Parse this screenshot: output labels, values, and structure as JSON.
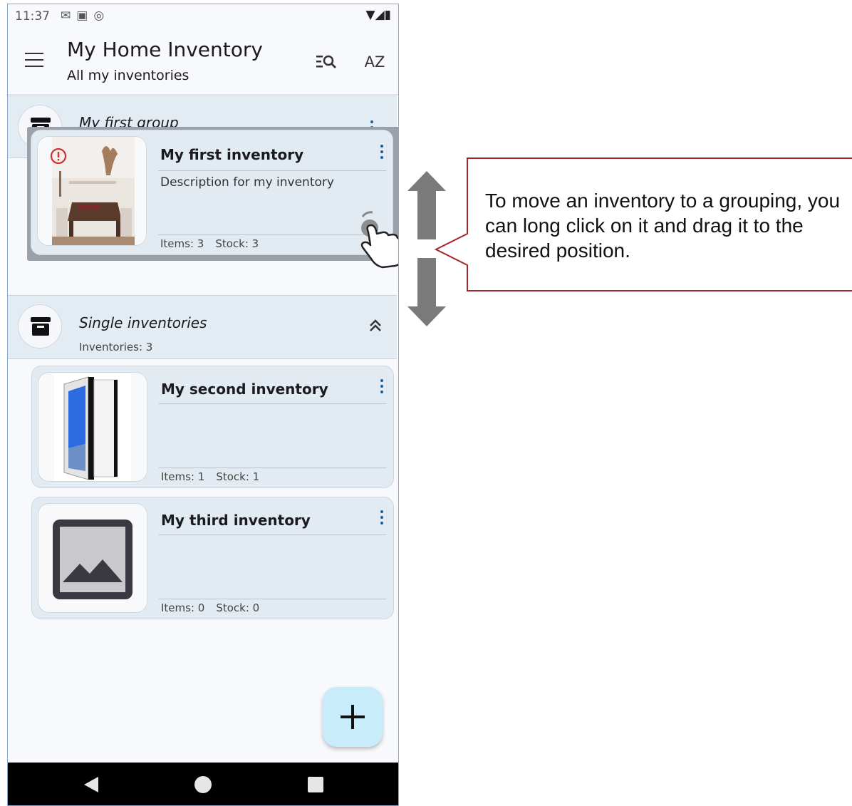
{
  "status_bar": {
    "time": "11:37",
    "left_icons": [
      "gmail-icon",
      "app-icon",
      "sync-icon"
    ],
    "right_icons": [
      "wifi-icon",
      "signal-icon",
      "battery-icon"
    ]
  },
  "app_bar": {
    "title": "My Home Inventory",
    "subtitle": "All my inventories",
    "sort_label": "AZ"
  },
  "groups": [
    {
      "name": "My first group"
    },
    {
      "name": "Single inventories",
      "count_label": "Inventories: 3"
    }
  ],
  "inventories": [
    {
      "name": "My first inventory",
      "description": "Description for my inventory",
      "items": "Items: 3",
      "stock": "Stock: 3",
      "image": "room-photo",
      "has_warning": true
    },
    {
      "name": "My second inventory",
      "description": "",
      "items": "Items: 1",
      "stock": "Stock: 1",
      "image": "pc-case-photo"
    },
    {
      "name": "My third inventory",
      "description": "",
      "items": "Items: 0",
      "stock": "Stock: 0",
      "image": "placeholder-image-icon"
    }
  ],
  "fab": {
    "icon": "plus-icon"
  },
  "nav": [
    "back-icon",
    "home-icon",
    "recents-icon"
  ],
  "annotation": {
    "text": "To move an inventory to a grouping, you can long click on it and drag it to the desired position.",
    "border_color": "#a0262a",
    "arrow_color": "#7a7a7a"
  },
  "colors": {
    "group_bg": "#e3ebf3",
    "card_bg": "#e3ebf2",
    "accent": "#1d5e96",
    "fab_bg": "#c9ecfb",
    "warning": "#d32f2f"
  }
}
